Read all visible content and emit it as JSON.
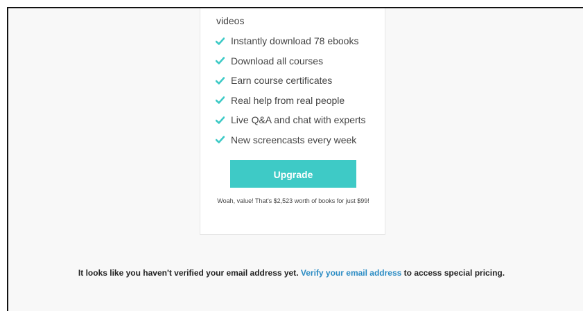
{
  "plan_card": {
    "wrapped_line": "videos",
    "features": [
      "Instantly download 78 ebooks",
      "Download all courses",
      "Earn course certificates",
      "Real help from real people",
      "Live Q&A and chat with experts",
      "New screencasts every week"
    ],
    "upgrade_label": "Upgrade",
    "value_note": "Woah, value! That's $2,523 worth of books for just $99!"
  },
  "verify_notice": {
    "text_before": "It looks like you haven't verified your email address yet.",
    "link_label": "Verify your email address",
    "text_after": "to access special pricing."
  },
  "colors": {
    "accent": "#3ecac6",
    "link": "#2b8cc4",
    "check": "#3ecac6"
  },
  "icons": {
    "feature_icon": "checkmark-icon"
  }
}
